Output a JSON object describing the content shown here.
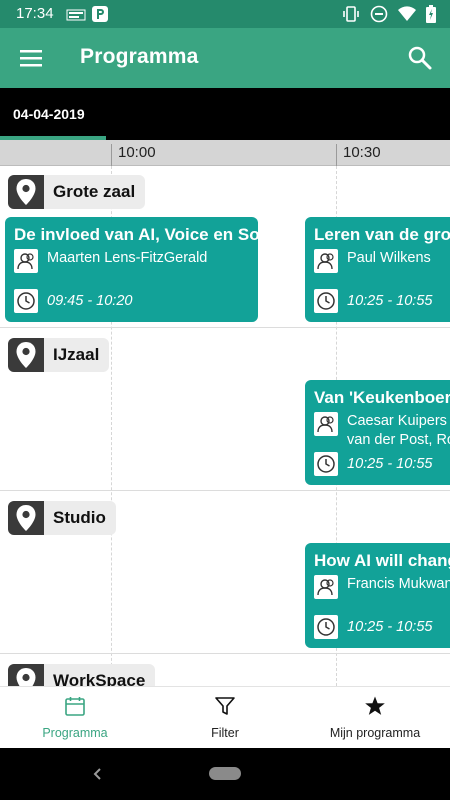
{
  "status_bar": {
    "time": "17:34",
    "left_icons": [
      "energy-app-icon",
      "parking-p-icon"
    ],
    "right_icons": [
      "vibrate-icon",
      "dnd-icon",
      "wifi-icon",
      "battery-icon"
    ]
  },
  "app_bar": {
    "title": "Programma",
    "menu_icon": "hamburger-menu-icon",
    "search_icon": "search-icon"
  },
  "date_tabs": [
    {
      "label": "04-04-2019",
      "selected": true
    }
  ],
  "timeline": {
    "labels": [
      "10:00",
      "10:30"
    ]
  },
  "rooms": [
    {
      "name": "Grote zaal",
      "sessions": [
        {
          "title": "De invloed van AI, Voice en So",
          "speakers": [
            "Maarten Lens-FitzGerald"
          ],
          "time": "09:45 - 10:20"
        },
        {
          "title": "Leren van de grote",
          "speakers": [
            "Paul Wilkens"
          ],
          "time": "10:25 - 10:55"
        }
      ]
    },
    {
      "name": "IJzaal",
      "sessions": [
        {
          "title": "Van 'Keukenboer' na",
          "speakers": [
            "Caesar  Kuipers",
            "van der Post, Ro"
          ],
          "time": "10:25 - 10:55"
        }
      ]
    },
    {
      "name": "Studio",
      "sessions": [
        {
          "title": "How AI will change",
          "speakers": [
            "Francis Mukwan"
          ],
          "time": "10:25 - 10:55"
        }
      ]
    },
    {
      "name": "WorkSpace",
      "sessions": []
    }
  ],
  "bottom_nav": {
    "items": [
      {
        "label": "Programma",
        "icon": "calendar-icon",
        "active": true
      },
      {
        "label": "Filter",
        "icon": "filter-funnel-icon",
        "active": false
      },
      {
        "label": "Mijn programma",
        "icon": "star-icon",
        "active": false
      }
    ]
  },
  "colors": {
    "status_bar": "#258a6c",
    "app_bar": "#3aa582",
    "session_card": "#12a298",
    "active_nav": "#3aa582"
  }
}
